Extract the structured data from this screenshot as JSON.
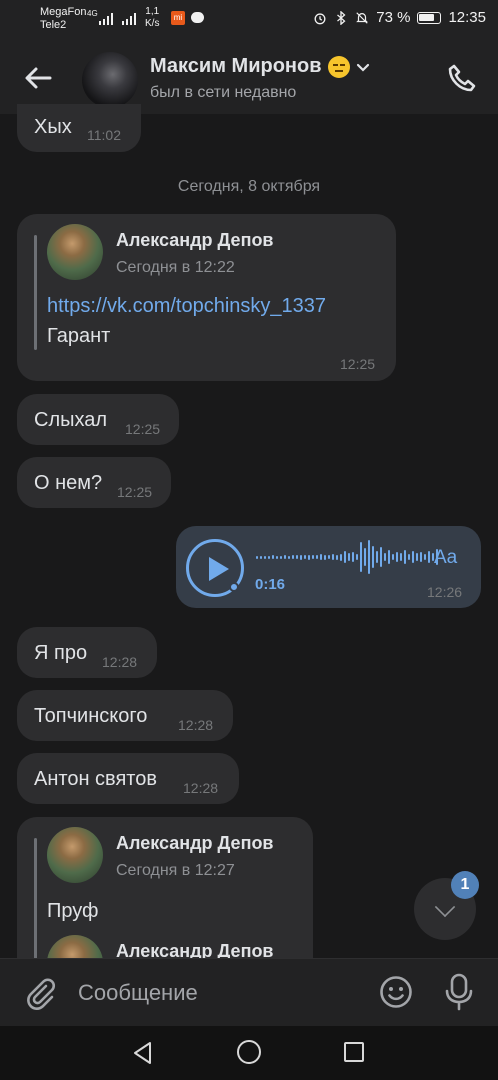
{
  "status_bar": {
    "carrier1": "MegaFon",
    "carrier2": "Tele2",
    "network": "4G",
    "speed_value": "1,1",
    "speed_unit": "K/s",
    "battery": "73 %",
    "time": "12:35"
  },
  "header": {
    "name": "Максим Миронов",
    "status": "был в сети недавно",
    "back_icon": "arrow-left-icon",
    "call_icon": "phone-icon"
  },
  "messages": {
    "m1": {
      "text": "Хых",
      "time": "11:02"
    },
    "date_separator": "Сегодня, 8 октября",
    "m2": {
      "forward_author": "Александр Депов",
      "forward_time": "Сегодня в 12:22",
      "link": "https://vk.com/topchinsky_1337",
      "text": "Гарант",
      "time": "12:25"
    },
    "m3": {
      "text": "Слыхал",
      "time": "12:25"
    },
    "m4": {
      "text": "О нем?",
      "time": "12:25"
    },
    "m5": {
      "duration": "0:16",
      "transcribe": "Aa",
      "time": "12:26"
    },
    "m6": {
      "text": "Я про",
      "time": "12:28"
    },
    "m7": {
      "text": "Топчинского",
      "time": "12:28"
    },
    "m8": {
      "text": "Антон святов",
      "time": "12:28"
    },
    "m9": {
      "forward_author": "Александр Депов",
      "forward_time": "Сегодня в 12:27",
      "text": "Пруф",
      "nested_author": "Александр Депов"
    }
  },
  "scroll_down": {
    "badge": "1"
  },
  "composer": {
    "placeholder": "Сообщение"
  },
  "colors": {
    "background": "#19191a",
    "bubble_in": "#2d2d2f",
    "bubble_out": "#353d48",
    "accent": "#71aaeb",
    "badge": "#5181b8"
  }
}
